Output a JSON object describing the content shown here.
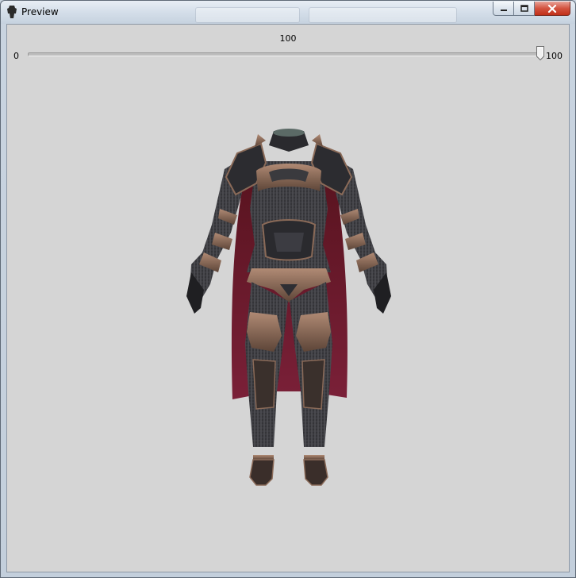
{
  "window": {
    "title": "Preview",
    "icons": {
      "app": "armor-figure-icon",
      "minimize": "minimize-icon",
      "maximize": "maximize-icon",
      "close": "close-icon"
    }
  },
  "slider": {
    "value_label": "100",
    "min_label": "0",
    "max_label": "100",
    "value": 100,
    "min": 0,
    "max": 100
  },
  "preview": {
    "subject": "armor-model",
    "colors": {
      "armor": "#3a3a3e",
      "trim": "#8a6a58",
      "cape": "#6e1e2a",
      "background": "#d5d5d5"
    }
  }
}
